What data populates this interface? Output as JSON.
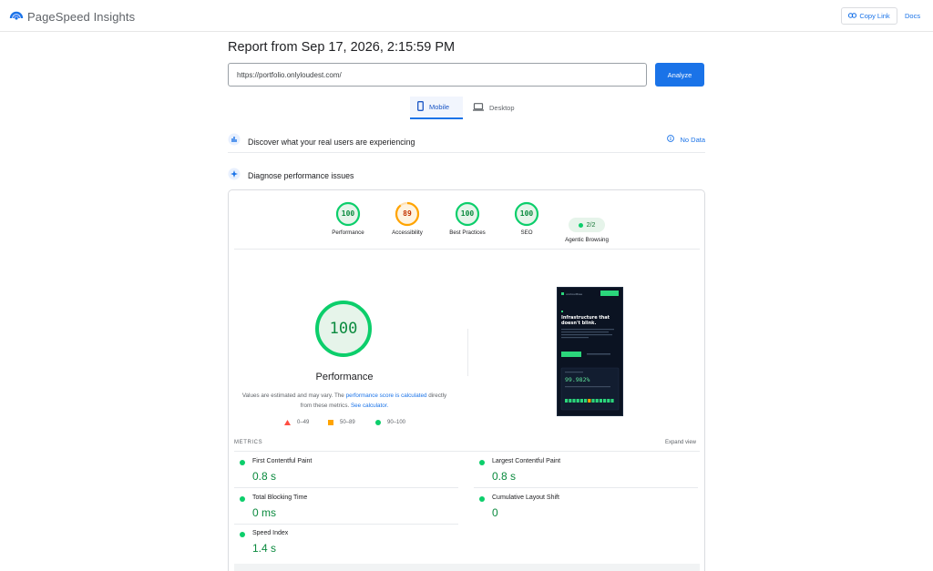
{
  "app": {
    "name": "PageSpeed Insights"
  },
  "toolbar": {
    "copy_link_label": "Copy Link",
    "docs_label": "Docs"
  },
  "report": {
    "title": "Report from Sep 17, 2026, 2:15:59 PM",
    "url": "https://portfolio.onlyloudest.com/",
    "analyze_label": "Analyze"
  },
  "tabs": [
    {
      "label": "Mobile",
      "selected": true
    },
    {
      "label": "Desktop",
      "selected": false
    }
  ],
  "discover": {
    "label": "Discover what your real users are experiencing",
    "status": "No Data"
  },
  "diagnose": {
    "label": "Diagnose performance issues"
  },
  "gauges": [
    {
      "label": "Performance",
      "score": "100",
      "color": "#0cce6b"
    },
    {
      "label": "Accessibility",
      "score": "89",
      "color": "#ffa400"
    },
    {
      "label": "Best Practices",
      "score": "100",
      "color": "#0cce6b"
    },
    {
      "label": "SEO",
      "score": "100",
      "color": "#0cce6b"
    }
  ],
  "agentic": {
    "label": "Agentic Browsing",
    "value": "2/2"
  },
  "performance": {
    "score": "100",
    "title": "Performance",
    "note_prefix": "Values are estimated and may vary. The ",
    "note_link1": "performance score is calculated",
    "note_middle": " directly from these metrics. ",
    "note_link2": "See calculator.",
    "legend": [
      {
        "range": "0–49",
        "shape": "triangle",
        "color": "#ff4e42"
      },
      {
        "range": "50–89",
        "shape": "square",
        "color": "#ffa400"
      },
      {
        "range": "90–100",
        "shape": "circle",
        "color": "#0cce6b"
      }
    ]
  },
  "screenshot": {
    "brand": "uncloudtree",
    "headline_line1": "Infrastructure that",
    "headline_line2": "doesn't blink.",
    "uptime": "99.982%"
  },
  "metrics": {
    "header": "METRICS",
    "expand_label": "Expand view",
    "items": [
      {
        "name": "First Contentful Paint",
        "value": "0.8 s"
      },
      {
        "name": "Largest Contentful Paint",
        "value": "0.8 s"
      },
      {
        "name": "Total Blocking Time",
        "value": "0 ms"
      },
      {
        "name": "Cumulative Layout Shift",
        "value": "0"
      },
      {
        "name": "Speed Index",
        "value": "1.4 s"
      }
    ]
  },
  "colors": {
    "accent": "#1a73e8",
    "pass": "#0cce6b",
    "average": "#ffa400",
    "fail": "#ff4e42"
  }
}
